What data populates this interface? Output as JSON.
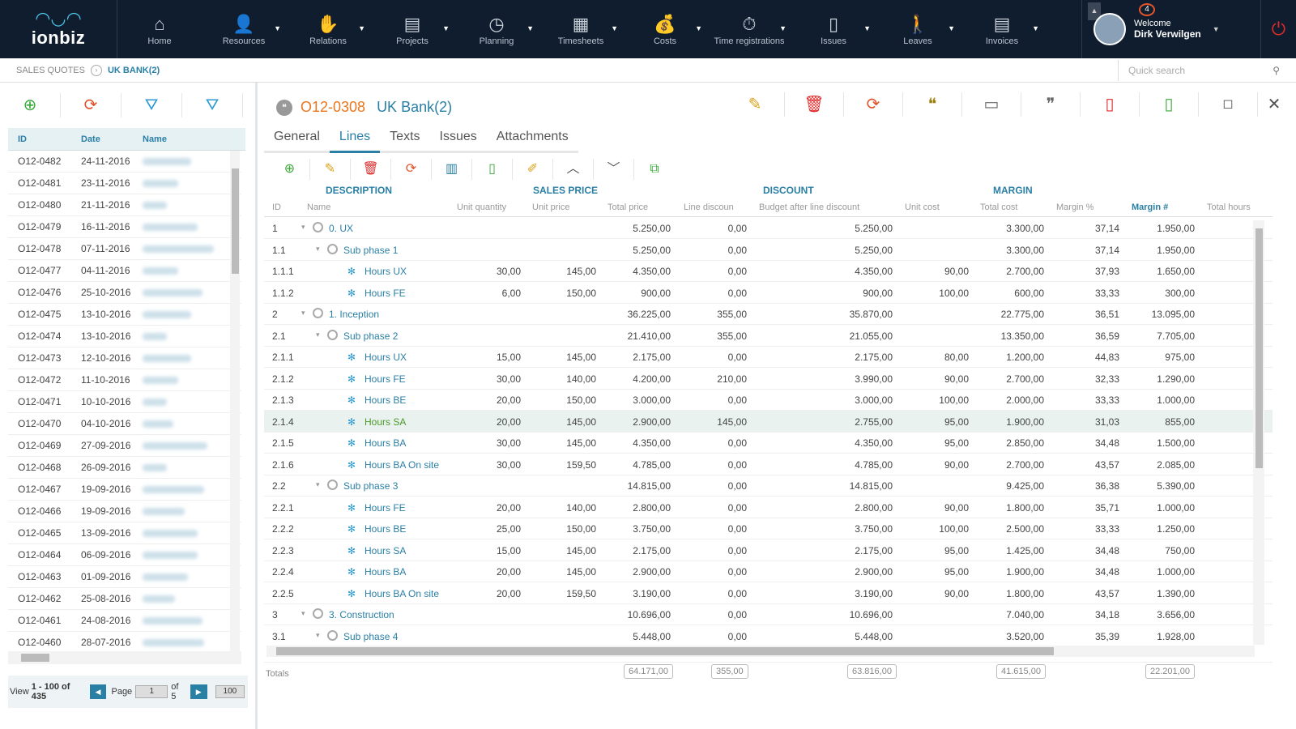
{
  "brand": {
    "name": "ionbiz"
  },
  "nav": [
    {
      "label": "Home",
      "icon": "home-icon",
      "caret": false
    },
    {
      "label": "Resources",
      "icon": "users-icon",
      "caret": true
    },
    {
      "label": "Relations",
      "icon": "handshake-icon",
      "caret": true
    },
    {
      "label": "Projects",
      "icon": "folder-icon",
      "caret": true
    },
    {
      "label": "Planning",
      "icon": "clock-icon",
      "caret": true
    },
    {
      "label": "Timesheets",
      "icon": "timesheet-icon",
      "caret": true
    },
    {
      "label": "Costs",
      "icon": "money-bag-icon",
      "caret": true
    },
    {
      "label": "Time registrations",
      "icon": "stopwatch-icon",
      "caret": true
    },
    {
      "label": "Issues",
      "icon": "issue-icon",
      "caret": true
    },
    {
      "label": "Leaves",
      "icon": "walking-icon",
      "caret": true
    },
    {
      "label": "Invoices",
      "icon": "invoice-icon",
      "caret": true
    }
  ],
  "user": {
    "welcome": "Welcome",
    "name": "Dirk Verwilgen",
    "notifications": "4"
  },
  "breadcrumb": {
    "root": "SALES QUOTES",
    "current": "UK BANK(2)"
  },
  "search": {
    "placeholder": "Quick search"
  },
  "list": {
    "headers": {
      "id": "ID",
      "date": "Date",
      "name": "Name"
    },
    "rows": [
      {
        "id": "O12-0482",
        "date": "24-11-2016"
      },
      {
        "id": "O12-0481",
        "date": "23-11-2016"
      },
      {
        "id": "O12-0480",
        "date": "21-11-2016"
      },
      {
        "id": "O12-0479",
        "date": "16-11-2016"
      },
      {
        "id": "O12-0478",
        "date": "07-11-2016"
      },
      {
        "id": "O12-0477",
        "date": "04-11-2016"
      },
      {
        "id": "O12-0476",
        "date": "25-10-2016"
      },
      {
        "id": "O12-0475",
        "date": "13-10-2016"
      },
      {
        "id": "O12-0474",
        "date": "13-10-2016"
      },
      {
        "id": "O12-0473",
        "date": "12-10-2016"
      },
      {
        "id": "O12-0472",
        "date": "11-10-2016"
      },
      {
        "id": "O12-0471",
        "date": "10-10-2016"
      },
      {
        "id": "O12-0470",
        "date": "04-10-2016"
      },
      {
        "id": "O12-0469",
        "date": "27-09-2016"
      },
      {
        "id": "O12-0468",
        "date": "26-09-2016"
      },
      {
        "id": "O12-0467",
        "date": "19-09-2016"
      },
      {
        "id": "O12-0466",
        "date": "19-09-2016"
      },
      {
        "id": "O12-0465",
        "date": "13-09-2016"
      },
      {
        "id": "O12-0464",
        "date": "06-09-2016"
      },
      {
        "id": "O12-0463",
        "date": "01-09-2016"
      },
      {
        "id": "O12-0462",
        "date": "25-08-2016"
      },
      {
        "id": "O12-0461",
        "date": "24-08-2016"
      },
      {
        "id": "O12-0460",
        "date": "28-07-2016"
      }
    ],
    "pager": {
      "view": "View",
      "range": "1 - 100 of 435",
      "page_label": "Page",
      "page": "1",
      "of": "of 5",
      "size": "100"
    }
  },
  "record": {
    "number": "O12-0308",
    "name": "UK Bank(2)"
  },
  "tabs": [
    {
      "label": "General"
    },
    {
      "label": "Lines",
      "active": true
    },
    {
      "label": "Texts"
    },
    {
      "label": "Issues"
    },
    {
      "label": "Attachments"
    }
  ],
  "groups": {
    "description": "DESCRIPTION",
    "sales_price": "SALES PRICE",
    "discount": "DISCOUNT",
    "margin": "MARGIN"
  },
  "columns": {
    "id": "ID",
    "name": "Name",
    "unit_qty": "Unit quantity",
    "unit_price": "Unit price",
    "total_price": "Total price",
    "line_discount": "Line discoun",
    "budget": "Budget after line discount",
    "unit_cost": "Unit cost",
    "total_cost": "Total cost",
    "margin_pct": "Margin %",
    "margin_num": "Margin #",
    "total_hours": "Total hours"
  },
  "lines": [
    {
      "id": "1",
      "level": 0,
      "name": "0. UX",
      "qty": "",
      "uprice": "",
      "total": "5.250,00",
      "disc": "0,00",
      "budget": "5.250,00",
      "ucost": "",
      "tcost": "3.300,00",
      "mpct": "37,14",
      "mnum": "1.950,00"
    },
    {
      "id": "1.1",
      "level": 1,
      "name": "Sub phase 1",
      "qty": "",
      "uprice": "",
      "total": "5.250,00",
      "disc": "0,00",
      "budget": "5.250,00",
      "ucost": "",
      "tcost": "3.300,00",
      "mpct": "37,14",
      "mnum": "1.950,00"
    },
    {
      "id": "1.1.1",
      "level": 2,
      "name": "Hours UX",
      "qty": "30,00",
      "uprice": "145,00",
      "total": "4.350,00",
      "disc": "0,00",
      "budget": "4.350,00",
      "ucost": "90,00",
      "tcost": "2.700,00",
      "mpct": "37,93",
      "mnum": "1.650,00"
    },
    {
      "id": "1.1.2",
      "level": 2,
      "name": "Hours FE",
      "qty": "6,00",
      "uprice": "150,00",
      "total": "900,00",
      "disc": "0,00",
      "budget": "900,00",
      "ucost": "100,00",
      "tcost": "600,00",
      "mpct": "33,33",
      "mnum": "300,00"
    },
    {
      "id": "2",
      "level": 0,
      "name": "1. Inception",
      "qty": "",
      "uprice": "",
      "total": "36.225,00",
      "disc": "355,00",
      "budget": "35.870,00",
      "ucost": "",
      "tcost": "22.775,00",
      "mpct": "36,51",
      "mnum": "13.095,00"
    },
    {
      "id": "2.1",
      "level": 1,
      "name": "Sub phase 2",
      "qty": "",
      "uprice": "",
      "total": "21.410,00",
      "disc": "355,00",
      "budget": "21.055,00",
      "ucost": "",
      "tcost": "13.350,00",
      "mpct": "36,59",
      "mnum": "7.705,00"
    },
    {
      "id": "2.1.1",
      "level": 2,
      "name": "Hours UX",
      "qty": "15,00",
      "uprice": "145,00",
      "total": "2.175,00",
      "disc": "0,00",
      "budget": "2.175,00",
      "ucost": "80,00",
      "tcost": "1.200,00",
      "mpct": "44,83",
      "mnum": "975,00"
    },
    {
      "id": "2.1.2",
      "level": 2,
      "name": "Hours FE",
      "qty": "30,00",
      "uprice": "140,00",
      "total": "4.200,00",
      "disc": "210,00",
      "budget": "3.990,00",
      "ucost": "90,00",
      "tcost": "2.700,00",
      "mpct": "32,33",
      "mnum": "1.290,00"
    },
    {
      "id": "2.1.3",
      "level": 2,
      "name": "Hours BE",
      "qty": "20,00",
      "uprice": "150,00",
      "total": "3.000,00",
      "disc": "0,00",
      "budget": "3.000,00",
      "ucost": "100,00",
      "tcost": "2.000,00",
      "mpct": "33,33",
      "mnum": "1.000,00"
    },
    {
      "id": "2.1.4",
      "level": 2,
      "name": "Hours SA",
      "qty": "20,00",
      "uprice": "145,00",
      "total": "2.900,00",
      "disc": "145,00",
      "budget": "2.755,00",
      "ucost": "95,00",
      "tcost": "1.900,00",
      "mpct": "31,03",
      "mnum": "855,00",
      "selected": true
    },
    {
      "id": "2.1.5",
      "level": 2,
      "name": "Hours BA",
      "qty": "30,00",
      "uprice": "145,00",
      "total": "4.350,00",
      "disc": "0,00",
      "budget": "4.350,00",
      "ucost": "95,00",
      "tcost": "2.850,00",
      "mpct": "34,48",
      "mnum": "1.500,00"
    },
    {
      "id": "2.1.6",
      "level": 2,
      "name": "Hours BA On site",
      "qty": "30,00",
      "uprice": "159,50",
      "total": "4.785,00",
      "disc": "0,00",
      "budget": "4.785,00",
      "ucost": "90,00",
      "tcost": "2.700,00",
      "mpct": "43,57",
      "mnum": "2.085,00"
    },
    {
      "id": "2.2",
      "level": 1,
      "name": "Sub phase 3",
      "qty": "",
      "uprice": "",
      "total": "14.815,00",
      "disc": "0,00",
      "budget": "14.815,00",
      "ucost": "",
      "tcost": "9.425,00",
      "mpct": "36,38",
      "mnum": "5.390,00"
    },
    {
      "id": "2.2.1",
      "level": 2,
      "name": "Hours FE",
      "qty": "20,00",
      "uprice": "140,00",
      "total": "2.800,00",
      "disc": "0,00",
      "budget": "2.800,00",
      "ucost": "90,00",
      "tcost": "1.800,00",
      "mpct": "35,71",
      "mnum": "1.000,00"
    },
    {
      "id": "2.2.2",
      "level": 2,
      "name": "Hours BE",
      "qty": "25,00",
      "uprice": "150,00",
      "total": "3.750,00",
      "disc": "0,00",
      "budget": "3.750,00",
      "ucost": "100,00",
      "tcost": "2.500,00",
      "mpct": "33,33",
      "mnum": "1.250,00"
    },
    {
      "id": "2.2.3",
      "level": 2,
      "name": "Hours SA",
      "qty": "15,00",
      "uprice": "145,00",
      "total": "2.175,00",
      "disc": "0,00",
      "budget": "2.175,00",
      "ucost": "95,00",
      "tcost": "1.425,00",
      "mpct": "34,48",
      "mnum": "750,00"
    },
    {
      "id": "2.2.4",
      "level": 2,
      "name": "Hours BA",
      "qty": "20,00",
      "uprice": "145,00",
      "total": "2.900,00",
      "disc": "0,00",
      "budget": "2.900,00",
      "ucost": "95,00",
      "tcost": "1.900,00",
      "mpct": "34,48",
      "mnum": "1.000,00"
    },
    {
      "id": "2.2.5",
      "level": 2,
      "name": "Hours BA On site",
      "qty": "20,00",
      "uprice": "159,50",
      "total": "3.190,00",
      "disc": "0,00",
      "budget": "3.190,00",
      "ucost": "90,00",
      "tcost": "1.800,00",
      "mpct": "43,57",
      "mnum": "1.390,00"
    },
    {
      "id": "3",
      "level": 0,
      "name": "3. Construction",
      "qty": "",
      "uprice": "",
      "total": "10.696,00",
      "disc": "0,00",
      "budget": "10.696,00",
      "ucost": "",
      "tcost": "7.040,00",
      "mpct": "34,18",
      "mnum": "3.656,00"
    },
    {
      "id": "3.1",
      "level": 1,
      "name": "Sub phase 4",
      "qty": "",
      "uprice": "",
      "total": "5.448,00",
      "disc": "0,00",
      "budget": "5.448,00",
      "ucost": "",
      "tcost": "3.520,00",
      "mpct": "35,39",
      "mnum": "1.928,00"
    }
  ],
  "totals": {
    "label": "Totals",
    "total_price": "64.171,00",
    "discount": "355,00",
    "budget": "63.816,00",
    "total_cost": "41.615,00",
    "margin": "22.201,00"
  }
}
